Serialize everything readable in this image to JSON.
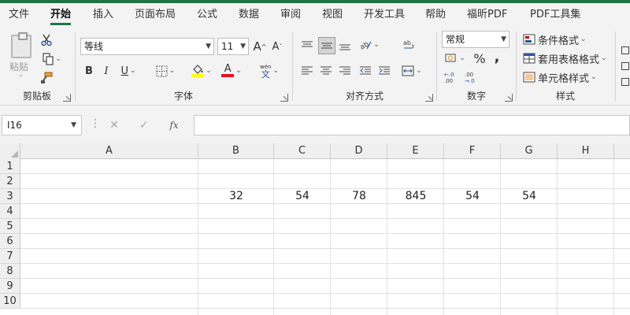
{
  "menu": {
    "tabs": [
      {
        "label": "文件"
      },
      {
        "label": "开始"
      },
      {
        "label": "插入"
      },
      {
        "label": "页面布局"
      },
      {
        "label": "公式"
      },
      {
        "label": "数据"
      },
      {
        "label": "审阅"
      },
      {
        "label": "视图"
      },
      {
        "label": "开发工具"
      },
      {
        "label": "帮助"
      },
      {
        "label": "福昕PDF"
      },
      {
        "label": "PDF工具集"
      }
    ],
    "active_tab": "开始"
  },
  "ribbon": {
    "clipboard": {
      "label": "剪贴板",
      "paste_label": "粘贴"
    },
    "font": {
      "label": "字体",
      "font_name": "等线",
      "font_size": "11",
      "bold": "B",
      "italic": "I",
      "underline": "U",
      "phonetic_top": "wén",
      "phonetic_bottom": "文",
      "highlight_color": "#ffff00",
      "font_color": "#e81123"
    },
    "alignment": {
      "label": "对齐方式"
    },
    "number": {
      "label": "数字",
      "format": "常规"
    },
    "styles": {
      "label": "样式",
      "conditional_format": "条件格式",
      "table_format": "套用表格格式",
      "cell_styles": "单元格样式"
    }
  },
  "formula_bar": {
    "name_box": "I16",
    "formula": ""
  },
  "sheet": {
    "columns": [
      "A",
      "B",
      "C",
      "D",
      "E",
      "F",
      "G",
      "H"
    ],
    "rows": [
      "1",
      "2",
      "3",
      "4",
      "5",
      "6",
      "7",
      "8",
      "9",
      "10"
    ],
    "row3": {
      "B": "32",
      "C": "54",
      "D": "78",
      "E": "845",
      "F": "54",
      "G": "54"
    }
  },
  "colors": {
    "accent": "#217346"
  }
}
